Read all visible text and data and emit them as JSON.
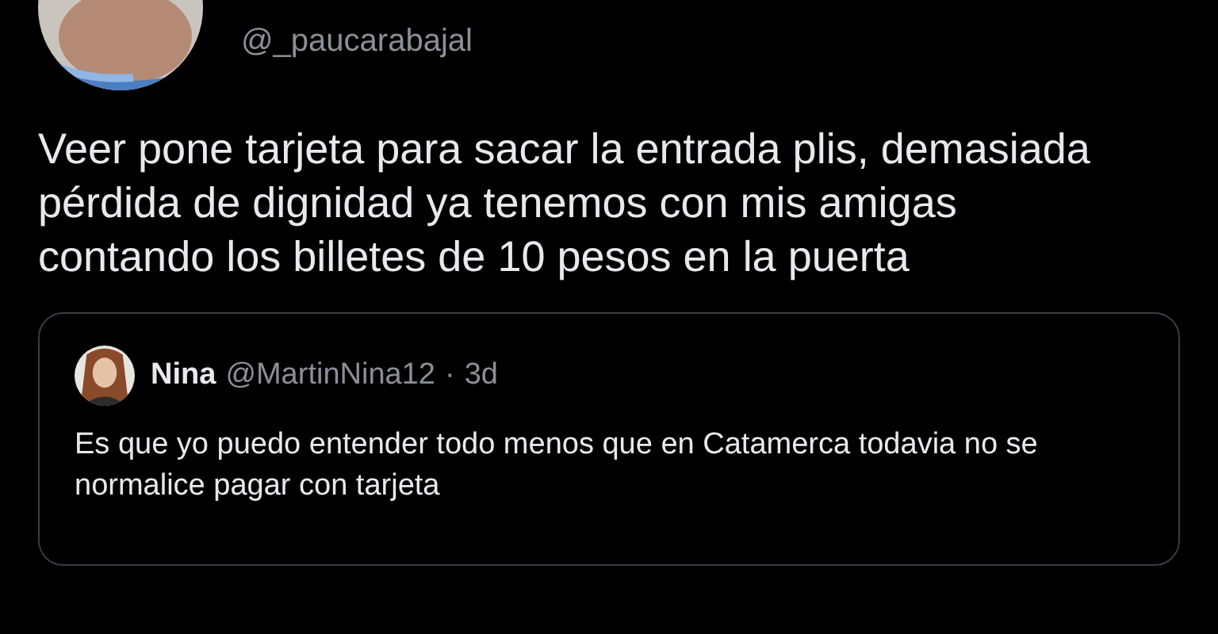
{
  "tweet": {
    "handle": "@_paucarabajal",
    "text": "Veer pone tarjeta para sacar la entrada plis, demasiada pérdida de dignidad ya tenemos con mis amigas contando los billetes de 10 pesos en la puerta"
  },
  "quoted_tweet": {
    "name": "Nina",
    "handle": "@MartinNina12",
    "separator": "·",
    "time": "3d",
    "text": "Es que yo puedo entender todo menos que en Catamerca todavia no se normalice pagar con tarjeta"
  }
}
